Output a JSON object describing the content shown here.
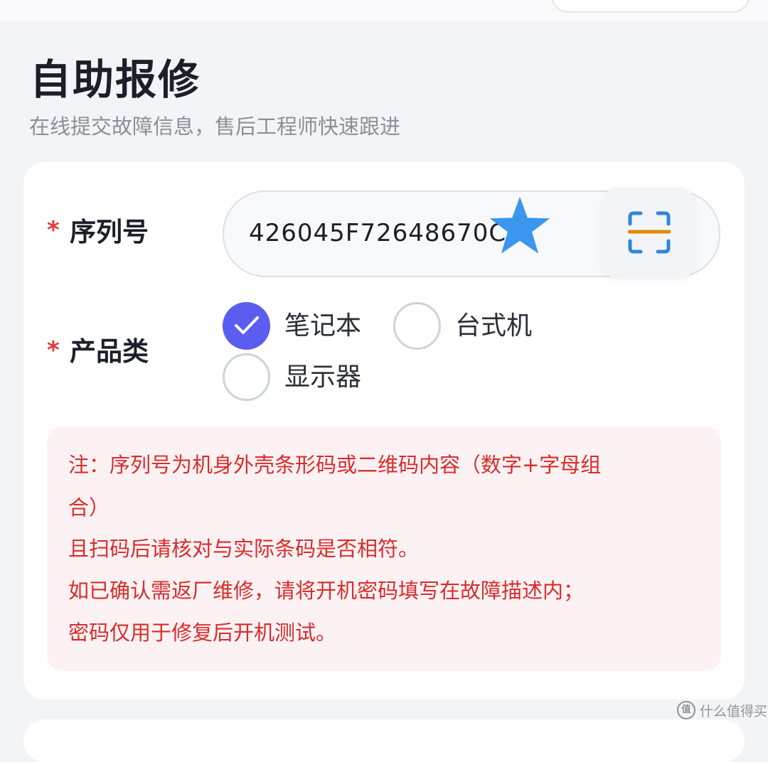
{
  "page": {
    "title": "自助报修",
    "subtitle": "在线提交故障信息，售后工程师快速跟进"
  },
  "form": {
    "required_mark": "*",
    "serial": {
      "label": "序列号",
      "value": "426045F72648670C",
      "scan_icon": "scan-icon",
      "overlay_icon": "star-icon"
    },
    "product": {
      "label": "产品类",
      "options": [
        {
          "label": "笔记本",
          "selected": true
        },
        {
          "label": "台式机",
          "selected": false
        },
        {
          "label": "显示器",
          "selected": false
        }
      ]
    },
    "note_lines": [
      "注：序列号为机身外壳条形码或二维码内容（数字+字母组",
      "合）",
      "且扫码后请核对与实际条码是否相符。",
      "如已确认需返厂维修，请将开机密码填写在故障描述内；",
      "密码仅用于修复后开机测试。"
    ]
  },
  "watermark": {
    "text": "什么值得买"
  },
  "colors": {
    "accent": "#5b5cf0",
    "required": "#e23b3b",
    "note_text": "#d92c2c",
    "note_bg": "#fdf2f3",
    "scan_corners": "#2f87d6",
    "scan_line": "#e08a00",
    "star": "#3b96ee"
  }
}
